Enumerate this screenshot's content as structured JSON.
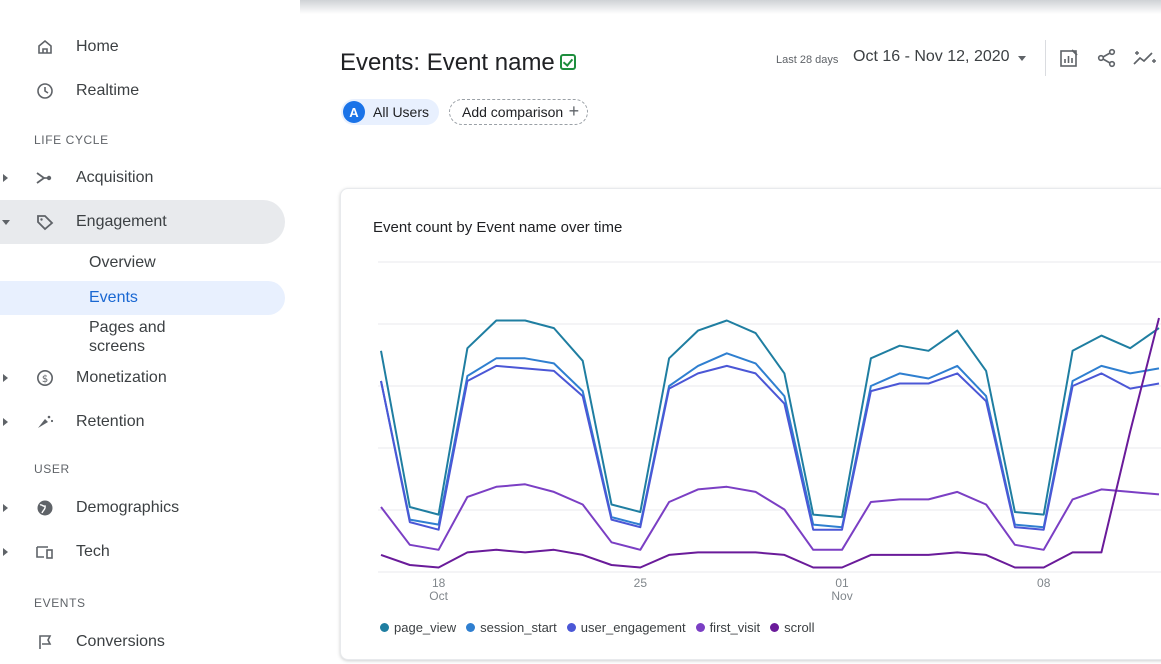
{
  "sidebar": {
    "home": {
      "label": "Home",
      "icon": "home-icon"
    },
    "realtime": {
      "label": "Realtime",
      "icon": "clock-icon"
    },
    "section_lifecycle": "LIFE CYCLE",
    "acquisition": {
      "label": "Acquisition",
      "icon": "acquisition-icon"
    },
    "engagement": {
      "label": "Engagement",
      "icon": "tag-icon"
    },
    "engagement_children": {
      "overview": "Overview",
      "events": "Events",
      "pages_line1": "Pages and",
      "pages_line2": "screens"
    },
    "monetization": {
      "label": "Monetization",
      "icon": "dollar-icon"
    },
    "retention": {
      "label": "Retention",
      "icon": "retention-icon"
    },
    "section_user": "USER",
    "demographics": {
      "label": "Demographics",
      "icon": "globe-icon"
    },
    "tech": {
      "label": "Tech",
      "icon": "devices-icon"
    },
    "section_events": "EVENTS",
    "conversions": {
      "label": "Conversions",
      "icon": "flag-icon"
    }
  },
  "header": {
    "title": "Events: Event name",
    "range_label": "Last 28 days",
    "date_range": "Oct 16 - Nov 12, 2020",
    "tools": [
      "customize-report-icon",
      "share-icon",
      "insights-icon"
    ]
  },
  "comparison": {
    "segment_letter": "A",
    "segment_label": "All Users",
    "add_label": "Add comparison",
    "add_symbol": "+"
  },
  "chart_data": {
    "type": "line",
    "title": "Event count by Event name over time",
    "x": [
      "Oct 16",
      "Oct 17",
      "Oct 18",
      "Oct 19",
      "Oct 20",
      "Oct 21",
      "Oct 22",
      "Oct 23",
      "Oct 24",
      "Oct 25",
      "Oct 26",
      "Oct 27",
      "Oct 28",
      "Oct 29",
      "Oct 30",
      "Oct 31",
      "Nov 1",
      "Nov 2",
      "Nov 3",
      "Nov 4",
      "Nov 5",
      "Nov 6",
      "Nov 7",
      "Nov 8",
      "Nov 9",
      "Nov 10",
      "Nov 11",
      "Nov 12"
    ],
    "x_ticks": [
      {
        "index": 2,
        "day": "18",
        "month": "Oct"
      },
      {
        "index": 9,
        "day": "25",
        "month": ""
      },
      {
        "index": 16,
        "day": "01",
        "month": "Nov"
      },
      {
        "index": 23,
        "day": "08",
        "month": ""
      }
    ],
    "ylim": [
      0,
      100
    ],
    "grid": true,
    "legend_position": "bottom",
    "series": [
      {
        "name": "page_view",
        "color": "#1f7ea1",
        "values": [
          87,
          25,
          22,
          88,
          99,
          99,
          96,
          83,
          26,
          23,
          84,
          95,
          99,
          94,
          78,
          22,
          21,
          84,
          89,
          87,
          95,
          79,
          23,
          22,
          87,
          93,
          88,
          96
        ]
      },
      {
        "name": "session_start",
        "color": "#2f7fd0",
        "values": [
          75,
          20,
          18,
          77,
          84,
          84,
          82,
          71,
          21,
          18,
          73,
          81,
          86,
          82,
          69,
          18,
          17,
          73,
          78,
          76,
          81,
          69,
          18,
          17,
          75,
          81,
          78,
          80
        ]
      },
      {
        "name": "user_engagement",
        "color": "#4b57d6",
        "values": [
          75,
          19,
          16,
          75,
          81,
          80,
          79,
          69,
          20,
          17,
          72,
          78,
          81,
          78,
          66,
          16,
          16,
          71,
          74,
          74,
          78,
          67,
          17,
          16,
          73,
          78,
          72,
          74
        ]
      },
      {
        "name": "first_visit",
        "color": "#7b3fc4",
        "values": [
          25,
          10,
          8,
          29,
          33,
          34,
          31,
          26,
          11,
          8,
          27,
          32,
          33,
          31,
          24,
          8,
          8,
          27,
          28,
          28,
          31,
          26,
          10,
          8,
          28,
          32,
          31,
          30
        ]
      },
      {
        "name": "scroll",
        "color": "#6a1b9a",
        "values": [
          6,
          2,
          1,
          7,
          8,
          7,
          8,
          6,
          2,
          1,
          6,
          7,
          7,
          7,
          6,
          1,
          1,
          6,
          6,
          6,
          7,
          6,
          1,
          1,
          7,
          7,
          55,
          100
        ]
      }
    ]
  }
}
